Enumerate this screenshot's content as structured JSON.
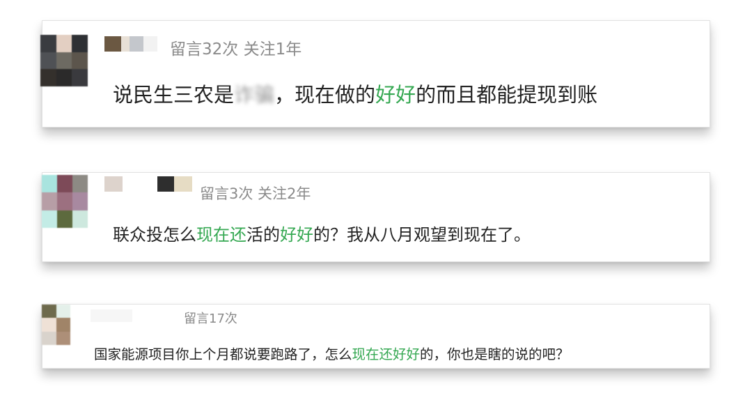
{
  "accent_color": "#35a852",
  "comments": [
    {
      "meta": "留言32次 关注1年",
      "segments": [
        {
          "text": "说民生三农是",
          "style": "normal"
        },
        {
          "text": "诈骗",
          "style": "blurred"
        },
        {
          "text": "，现在做的",
          "style": "normal"
        },
        {
          "text": "好好",
          "style": "green"
        },
        {
          "text": "的而且都能提现到账",
          "style": "normal"
        }
      ]
    },
    {
      "meta": "留言3次 关注2年",
      "segments": [
        {
          "text": "联众投怎么",
          "style": "normal"
        },
        {
          "text": "现在还",
          "style": "green"
        },
        {
          "text": "活的",
          "style": "normal"
        },
        {
          "text": "好好",
          "style": "green"
        },
        {
          "text": "的？我从八月观望到现在了。",
          "style": "normal"
        }
      ]
    },
    {
      "meta": "留言17次",
      "segments": [
        {
          "text": "国家能源项目你上个月都说要跑路了，怎么",
          "style": "normal"
        },
        {
          "text": "现在还好好",
          "style": "green"
        },
        {
          "text": "的，你也是瞎的说的吧？",
          "style": "normal"
        }
      ]
    }
  ]
}
